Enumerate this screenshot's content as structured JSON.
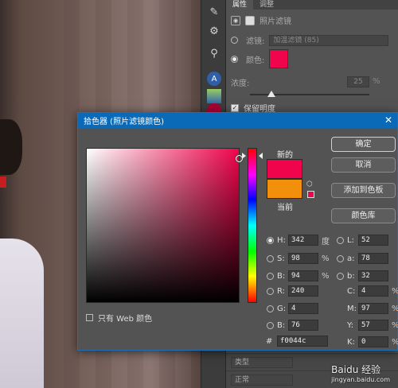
{
  "panel": {
    "tabs": [
      "属性",
      "调整"
    ],
    "layer_name": "照片滤镜",
    "filter_label": "滤镜:",
    "filter_value": "加温滤镜 (85)",
    "color_label": "颜色:",
    "density_label": "浓度:",
    "density_value": "25",
    "density_unit": "%",
    "preserve_luminosity": "保留明度",
    "bottom_kind": "类型",
    "bottom_blend": "正常"
  },
  "dialog": {
    "title": "拾色器 (照片滤镜颜色)",
    "new_label": "新的",
    "current_label": "当前",
    "new_color": "#f0044c",
    "current_color": "#f2900c",
    "buttons": {
      "ok": "确定",
      "cancel": "取消",
      "add_to_swatches": "添加到色板",
      "color_libraries": "颜色库"
    },
    "web_only_label": "只有 Web 颜色",
    "hsb": [
      {
        "label": "H:",
        "value": "342",
        "unit": "度",
        "checked": true
      },
      {
        "label": "S:",
        "value": "98",
        "unit": "%",
        "checked": false
      },
      {
        "label": "B:",
        "value": "94",
        "unit": "%",
        "checked": false
      }
    ],
    "rgb": [
      {
        "label": "R:",
        "value": "240"
      },
      {
        "label": "G:",
        "value": "4"
      },
      {
        "label": "B:",
        "value": "76"
      }
    ],
    "lab": [
      {
        "label": "L:",
        "value": "52"
      },
      {
        "label": "a:",
        "value": "78"
      },
      {
        "label": "b:",
        "value": "32"
      }
    ],
    "cmyk": [
      {
        "label": "C:",
        "value": "4",
        "unit": "%"
      },
      {
        "label": "M:",
        "value": "97",
        "unit": "%"
      },
      {
        "label": "Y:",
        "value": "57",
        "unit": "%"
      },
      {
        "label": "K:",
        "value": "0",
        "unit": "%"
      }
    ],
    "hex_label": "#",
    "hex_value": "f0044c"
  },
  "watermark": {
    "brand": "Baidu 经验",
    "url": "jingyan.baidu.com"
  }
}
